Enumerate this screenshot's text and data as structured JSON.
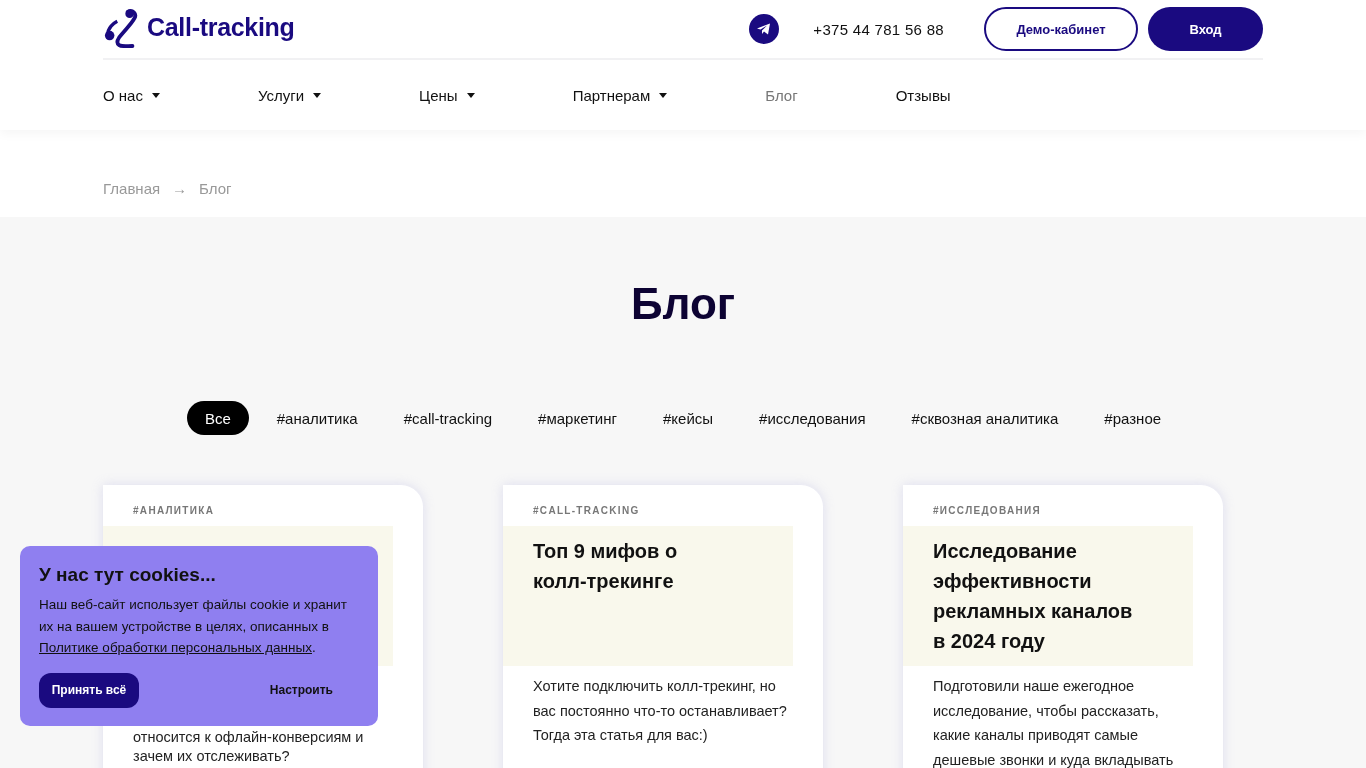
{
  "header": {
    "logo": "Call-tracking",
    "phone": "+375 44 781 56 88",
    "buttons": [
      {
        "label": "Демо-кабинет",
        "kind": "outline"
      },
      {
        "label": "Вход",
        "kind": "filled"
      }
    ]
  },
  "nav": [
    {
      "label": "О нас",
      "dropdown": true,
      "selected": false
    },
    {
      "label": "Услуги",
      "dropdown": true,
      "selected": false
    },
    {
      "label": "Цены",
      "dropdown": true,
      "selected": false
    },
    {
      "label": "Партнерам",
      "dropdown": true,
      "selected": false
    },
    {
      "label": "Блог",
      "dropdown": false,
      "selected": true
    },
    {
      "label": "Отзывы",
      "dropdown": false,
      "selected": false
    }
  ],
  "breadcrumbs": {
    "items": [
      "Главная",
      "Блог"
    ],
    "separator": "→"
  },
  "page_title": "Блог",
  "tags": [
    {
      "label": "Все",
      "selected": true
    },
    {
      "label": "#аналитика",
      "selected": false
    },
    {
      "label": "#call-tracking",
      "selected": false
    },
    {
      "label": "#маркетинг",
      "selected": false
    },
    {
      "label": "#кейсы",
      "selected": false
    },
    {
      "label": "#исследования",
      "selected": false
    },
    {
      "label": "#сквозная аналитика",
      "selected": false
    },
    {
      "label": "#разное",
      "selected": false
    }
  ],
  "cards": [
    {
      "tag": "#АНАЛИТИКА",
      "covered": true,
      "excerpt": "относится к офлайн-конверсиям и зачем их отслеживать?"
    },
    {
      "tag": "#CALL-TRACKING",
      "covered": false,
      "title": "Топ 9 мифов о колл-трекинге",
      "excerpt": "Хотите подключить колл-трекинг, но вас постоянно что-то останавливает? Тогда эта статья для вас:)"
    },
    {
      "tag": "#ИССЛЕДОВАНИЯ",
      "covered": false,
      "title": "Исследование эффективности рекламных каналов в 2024 году",
      "excerpt": "Подготовили наше ежегодное исследование, чтобы рассказать, какие каналы приводят самые дешевые звонки и куда вкладывать"
    }
  ],
  "cookie_banner": {
    "title": "У нас тут cookies...",
    "text": "Наш веб-сайт использует файлы cookie и хранит их на вашем устройстве в целях, описанных в",
    "link": "Политике обработки персональных данных",
    "text_end": ".",
    "buttons": [
      {
        "label": "Принять всё",
        "kind": "filled"
      },
      {
        "label": "Настроить",
        "kind": "plain"
      }
    ]
  }
}
